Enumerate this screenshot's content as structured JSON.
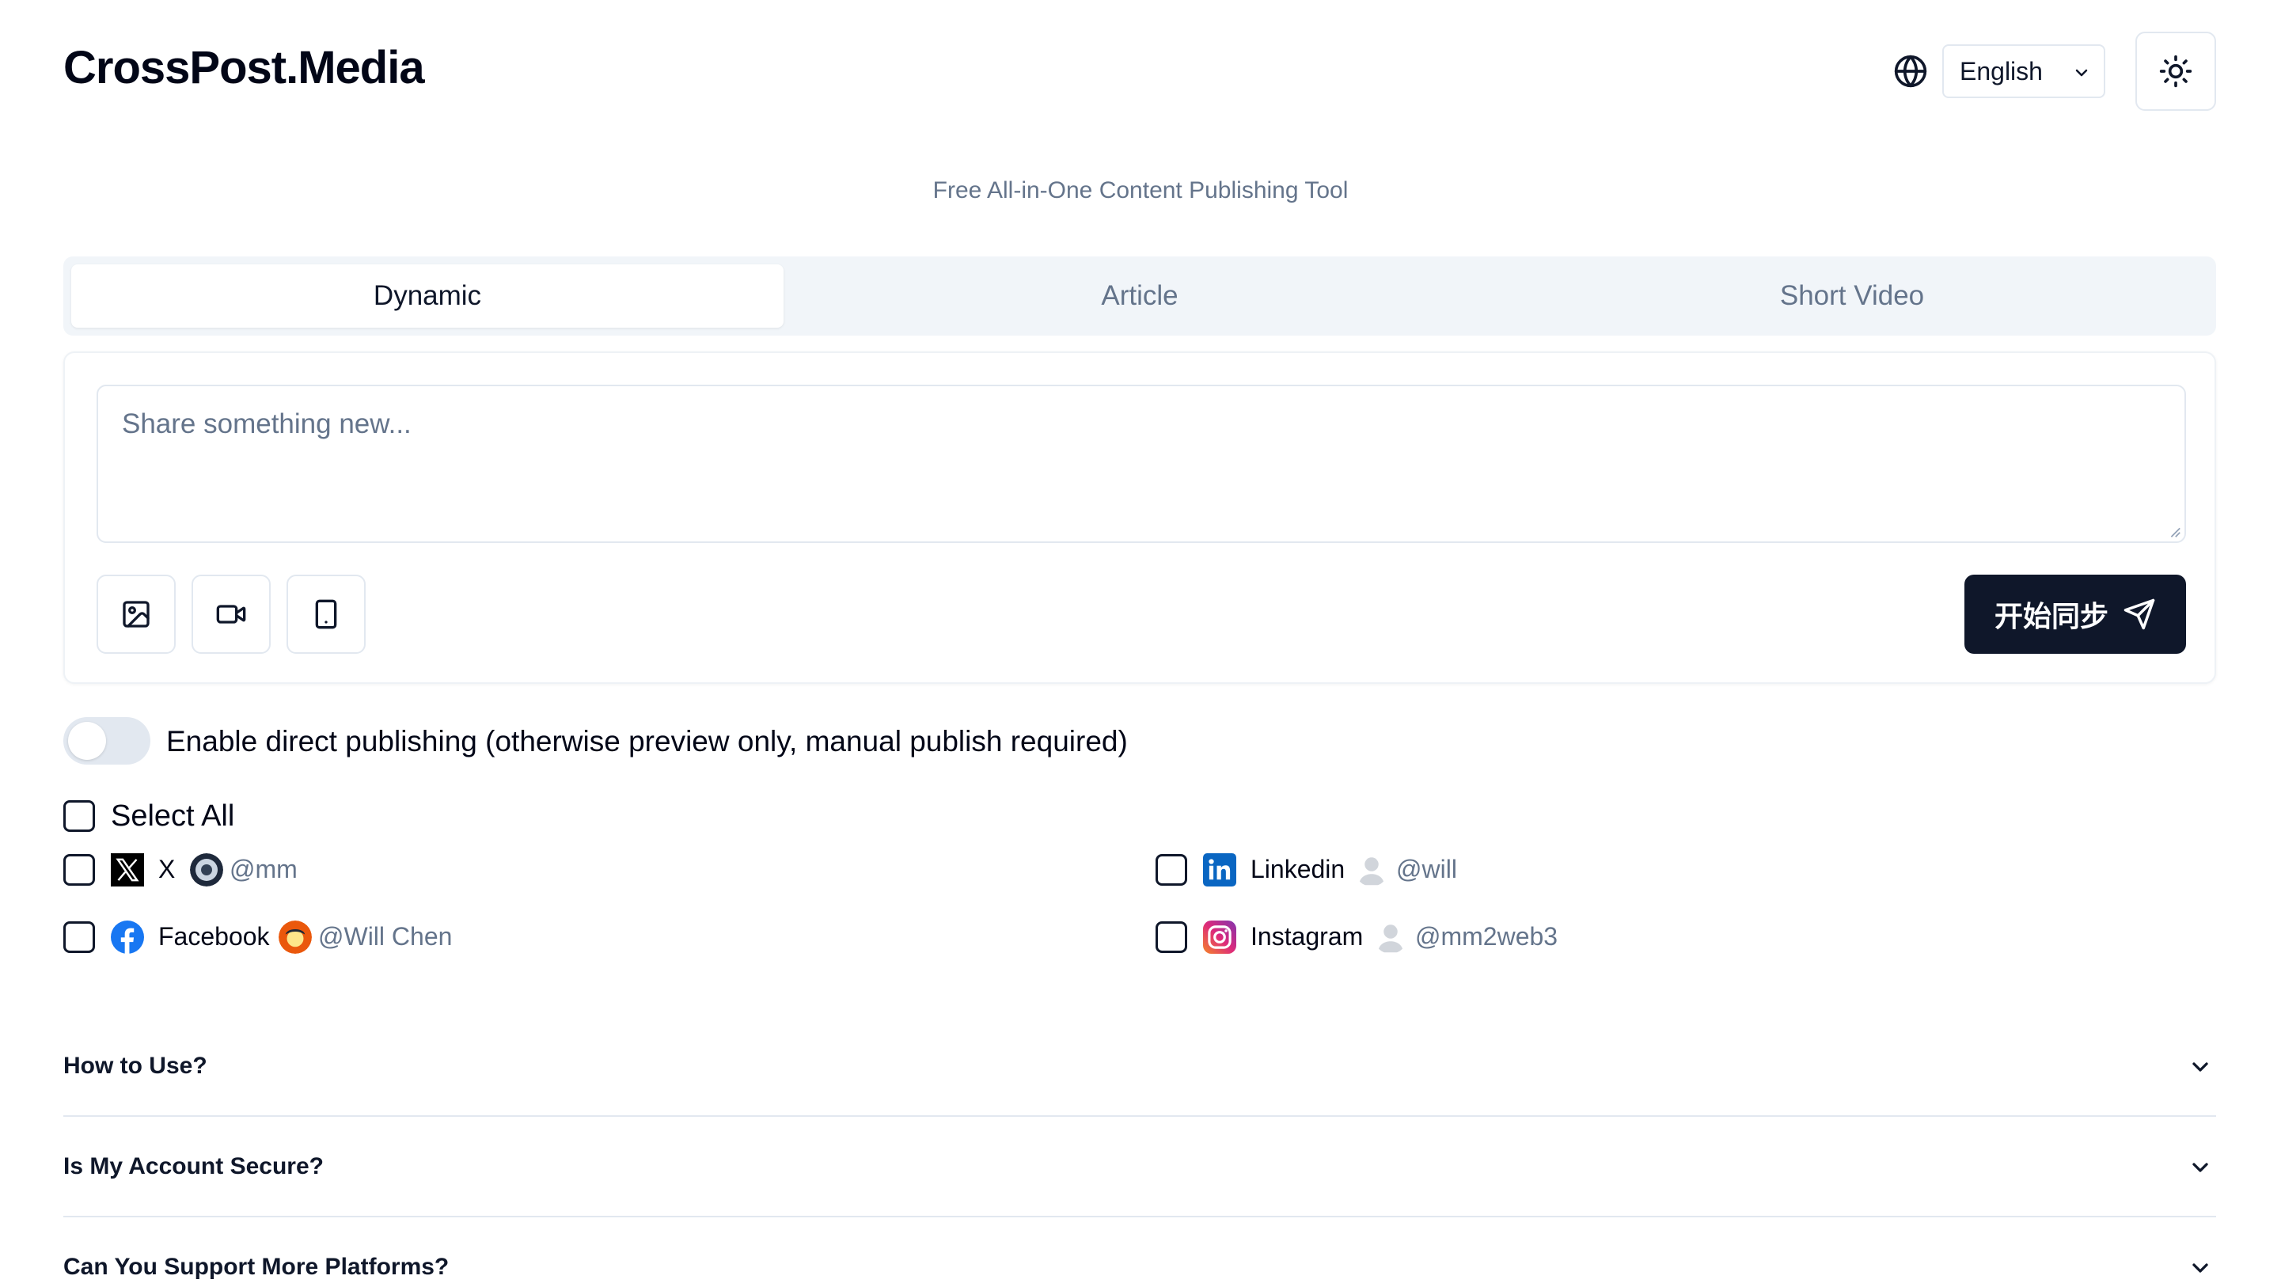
{
  "header": {
    "logo": "CrossPost.Media",
    "language": "English"
  },
  "subtitle": "Free All-in-One Content Publishing Tool",
  "tabs": [
    {
      "label": "Dynamic",
      "active": true
    },
    {
      "label": "Article",
      "active": false
    },
    {
      "label": "Short Video",
      "active": false
    }
  ],
  "composer": {
    "placeholder": "Share something new...",
    "tools": [
      "image-icon",
      "video-icon",
      "phone-icon"
    ],
    "sync_label": "开始同步"
  },
  "direct_publish": {
    "label": "Enable direct publishing (otherwise preview only, manual publish required)",
    "enabled": false
  },
  "select_all": {
    "label": "Select All",
    "checked": false
  },
  "platforms": [
    {
      "name": "X",
      "handle": "@mm",
      "checked": false,
      "icon": "x-logo-icon"
    },
    {
      "name": "Linkedin",
      "handle": "@will",
      "checked": false,
      "icon": "linkedin-icon"
    },
    {
      "name": "Facebook",
      "handle": "@Will Chen",
      "checked": false,
      "icon": "facebook-icon"
    },
    {
      "name": "Instagram",
      "handle": "@mm2web3",
      "checked": false,
      "icon": "instagram-icon"
    }
  ],
  "faq": [
    {
      "question": "How to Use?"
    },
    {
      "question": "Is My Account Secure?"
    },
    {
      "question": "Can You Support More Platforms?"
    }
  ],
  "colors": {
    "primary": "#0f172a",
    "muted_text": "#64748b",
    "border": "#e2e8f0",
    "tab_bg": "#f1f5f9",
    "linkedin": "#0a66c2",
    "facebook": "#1877f2"
  }
}
